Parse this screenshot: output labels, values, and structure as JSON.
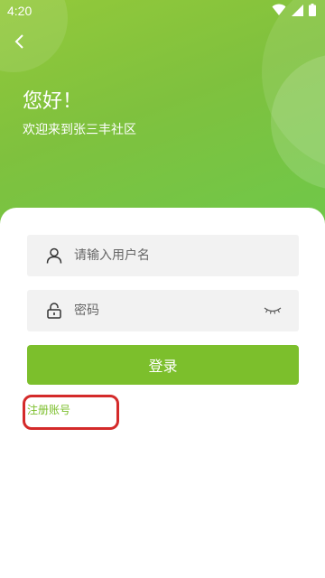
{
  "status_bar": {
    "time": "4:20",
    "icons": [
      "wifi-icon",
      "signal-icon",
      "battery-icon"
    ]
  },
  "header": {
    "back_icon": "chevron-left-icon",
    "greeting": "您好！",
    "welcome": "欢迎来到张三丰社区"
  },
  "form": {
    "username": {
      "placeholder": "请输入用户名",
      "value": "",
      "icon": "user-icon"
    },
    "password": {
      "placeholder": "密码",
      "value": "",
      "icon": "lock-icon",
      "toggle_icon": "eye-closed-icon"
    },
    "login_label": "登录",
    "register_label": "注册账号"
  },
  "colors": {
    "primary": "#7cbf2c",
    "hero_gradient_start": "#93c93a",
    "hero_gradient_end": "#6ec84a",
    "field_bg": "#f2f2f2",
    "highlight": "#d42a2a"
  }
}
